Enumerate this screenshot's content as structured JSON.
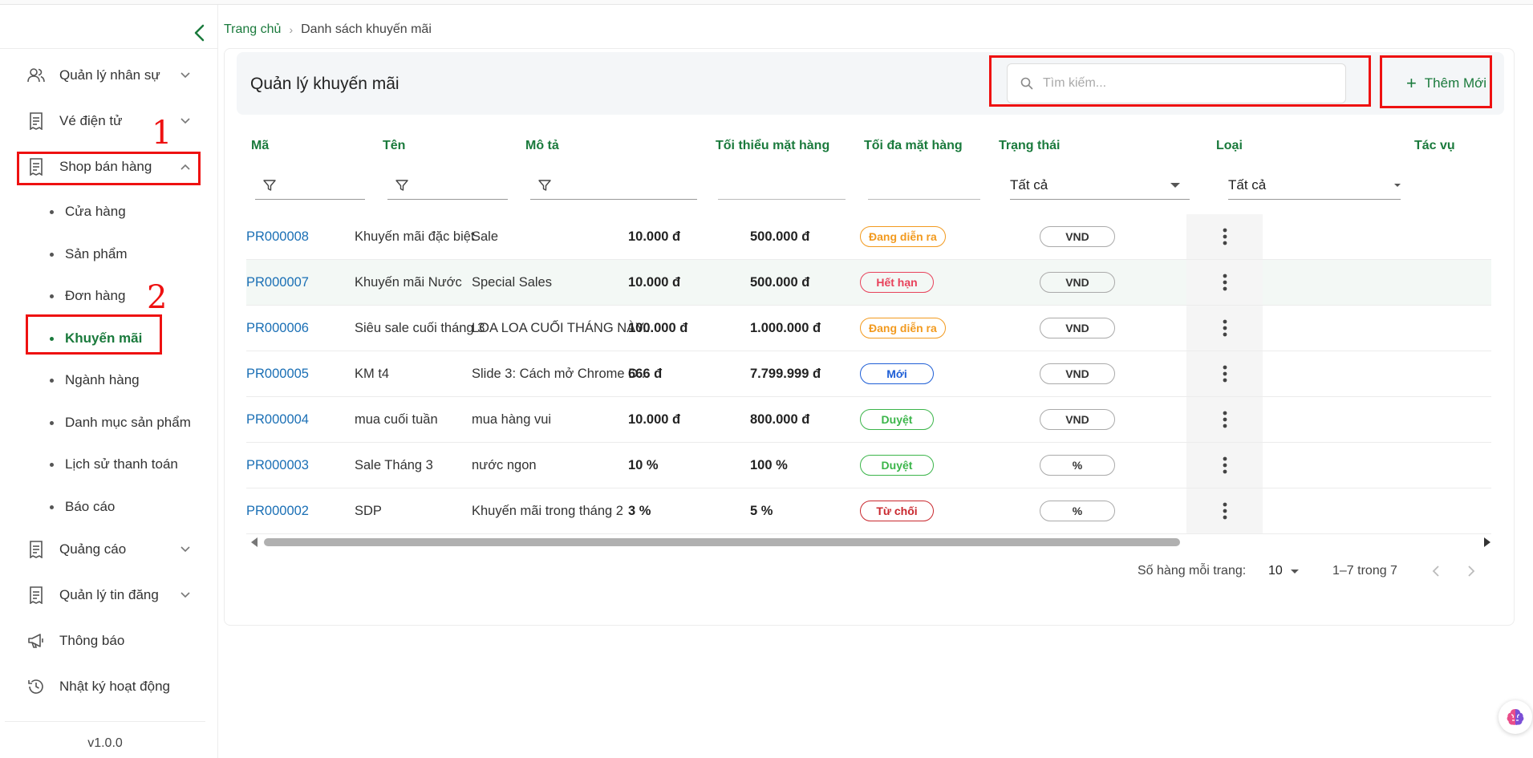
{
  "sidebar": {
    "items": [
      {
        "label": "Quản lý nhân sự",
        "icon": "users-icon"
      },
      {
        "label": "Vé điện tử",
        "icon": "receipt-icon"
      },
      {
        "label": "Shop bán hàng",
        "icon": "receipt-icon"
      }
    ],
    "sub_items": [
      "Cửa hàng",
      "Sản phẩm",
      "Đơn hàng",
      "Khuyến mãi",
      "Ngành hàng",
      "Danh mục sản phẩm",
      "Lịch sử thanh toán",
      "Báo cáo"
    ],
    "bottom_items": [
      {
        "label": "Quảng cáo",
        "icon": "receipt-icon"
      },
      {
        "label": "Quản lý tin đăng",
        "icon": "receipt-icon"
      },
      {
        "label": "Thông báo",
        "icon": "megaphone-icon"
      },
      {
        "label": "Nhật ký hoạt động",
        "icon": "history-icon"
      }
    ],
    "version": "v1.0.0"
  },
  "annotations": {
    "one": "1",
    "two": "2"
  },
  "breadcrumb": {
    "home": "Trang chủ",
    "current": "Danh sách khuyến mãi"
  },
  "header": {
    "title": "Quản lý khuyến mãi",
    "search_placeholder": "Tìm kiếm...",
    "add_label": "Thêm Mới"
  },
  "table": {
    "columns": [
      "Mã",
      "Tên",
      "Mô tả",
      "Tối thiểu mặt hàng",
      "Tối đa mặt hàng",
      "Trạng thái",
      "Loại",
      "Tác vụ"
    ],
    "filters": {
      "status": "Tất cả",
      "type": "Tất cả"
    },
    "rows": [
      {
        "code": "PR000008",
        "name": "Khuyến mãi đặc biệt",
        "desc": "Sale",
        "min": "10.000 đ",
        "max": "500.000 đ",
        "status": "Đang diễn ra",
        "type": "VND"
      },
      {
        "code": "PR000007",
        "name": "Khuyến mãi Nước",
        "desc": "Special Sales",
        "min": "10.000 đ",
        "max": "500.000 đ",
        "status": "Hết hạn",
        "type": "VND"
      },
      {
        "code": "PR000006",
        "name": "Siêu sale cuối tháng 3",
        "desc": "LOA LOA CUỐI THÁNG NÀY...",
        "min": "100.000 đ",
        "max": "1.000.000 đ",
        "status": "Đang diễn ra",
        "type": "VND"
      },
      {
        "code": "PR000005",
        "name": "KM t4",
        "desc": "Slide 3: Cách mở Chrome D...",
        "min": "666 đ",
        "max": "7.799.999 đ",
        "status": "Mới",
        "type": "VND"
      },
      {
        "code": "PR000004",
        "name": "mua cuối tuần",
        "desc": "mua hàng vui",
        "min": "10.000 đ",
        "max": "800.000 đ",
        "status": "Duyệt",
        "type": "VND"
      },
      {
        "code": "PR000003",
        "name": "Sale Tháng 3",
        "desc": "nước ngon",
        "min": "10 %",
        "max": "100 %",
        "status": "Duyệt",
        "type": "%"
      },
      {
        "code": "PR000002",
        "name": "SDP",
        "desc": "Khuyến mãi trong tháng 2",
        "min": "3 %",
        "max": "5 %",
        "status": "Từ chối",
        "type": "%"
      }
    ]
  },
  "status_colors": {
    "Đang diễn ra": "#f29a1f",
    "Hết hạn": "#e8425b",
    "Mới": "#1f5fd6",
    "Duyệt": "#3bb54a",
    "Từ chối": "#c9282e"
  },
  "pagination": {
    "rows_per_page_label": "Số hàng mỗi trang:",
    "rows_per_page": "10",
    "range": "1–7 trong 7"
  },
  "colors": {
    "accent": "#1a7a3c",
    "link": "#1a6fb5",
    "annotation": "#ee1111"
  }
}
